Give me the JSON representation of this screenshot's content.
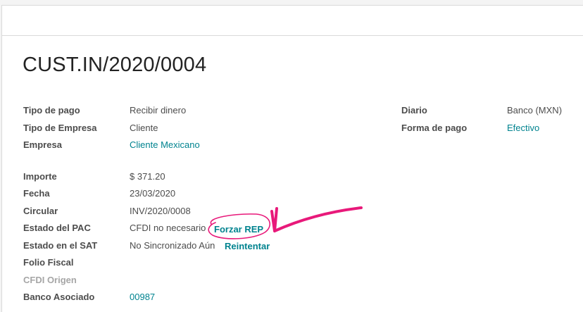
{
  "record": {
    "title": "CUST.IN/2020/0004"
  },
  "left_fields": {
    "tipo_pago": {
      "label": "Tipo de pago",
      "value": "Recibir dinero"
    },
    "tipo_empresa": {
      "label": "Tipo de Empresa",
      "value": "Cliente"
    },
    "empresa": {
      "label": "Empresa",
      "value": "Cliente Mexicano"
    },
    "importe": {
      "label": "Importe",
      "value": "$ 371.20"
    },
    "fecha": {
      "label": "Fecha",
      "value": "23/03/2020"
    },
    "circular": {
      "label": "Circular",
      "value": "INV/2020/0008"
    },
    "estado_pac": {
      "label": "Estado del PAC",
      "value": "CFDI no necesario",
      "action": "Forzar REP"
    },
    "estado_sat": {
      "label": "Estado en el SAT",
      "value": "No Sincronizado Aún",
      "action": "Reintentar"
    },
    "folio_fiscal": {
      "label": "Folio Fiscal",
      "value": ""
    },
    "cfdi_origen": {
      "label": "CFDI Origen",
      "value": ""
    },
    "banco_asociado": {
      "label": "Banco Asociado",
      "value": "00987"
    }
  },
  "right_fields": {
    "diario": {
      "label": "Diario",
      "value": "Banco (MXN)"
    },
    "forma_pago": {
      "label": "Forma de pago",
      "value": "Efectivo"
    }
  },
  "colors": {
    "link": "#00838f",
    "annotation": "#e8197a"
  }
}
